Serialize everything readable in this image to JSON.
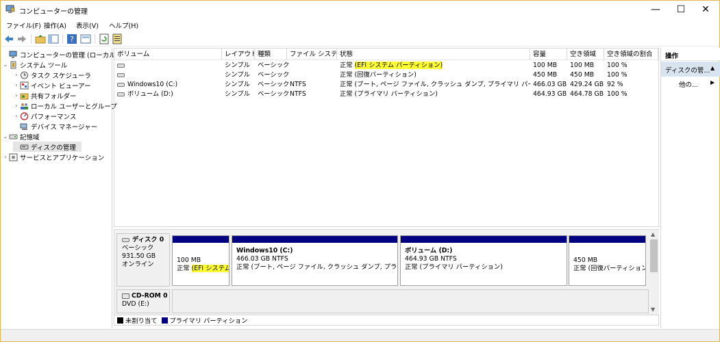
{
  "window": {
    "title": "コンピューターの管理",
    "minimize": "—",
    "maximize": "☐",
    "close": "✕"
  },
  "menu": [
    "ファイル(F)",
    "操作(A)",
    "表示(V)",
    "ヘルプ(H)"
  ],
  "tree": [
    {
      "label": "コンピューターの管理 (ローカル)",
      "icon": "computer-management-icon"
    },
    {
      "label": "システム ツール",
      "icon": "tools-icon"
    },
    {
      "label": "タスク スケジューラ",
      "icon": "clock-icon"
    },
    {
      "label": "イベント ビューアー",
      "icon": "event-viewer-icon"
    },
    {
      "label": "共有フォルダー",
      "icon": "shared-folder-icon"
    },
    {
      "label": "ローカル ユーザーとグループ",
      "icon": "users-icon"
    },
    {
      "label": "パフォーマンス",
      "icon": "performance-icon"
    },
    {
      "label": "デバイス マネージャー",
      "icon": "device-manager-icon"
    },
    {
      "label": "記憶域",
      "icon": "storage-icon"
    },
    {
      "label": "ディスクの管理",
      "icon": "disk-management-icon"
    },
    {
      "label": "サービスとアプリケーション",
      "icon": "services-icon"
    }
  ],
  "columns": [
    "ボリューム",
    "レイアウト",
    "種類",
    "ファイル システム",
    "状態",
    "容量",
    "空き領域",
    "空き領域の割合"
  ],
  "volumes": [
    {
      "name": "",
      "layout": "シンプル",
      "type": "ベーシック",
      "fs": "",
      "status": "正常 (EFI システム パーティション)",
      "capacity": "100 MB",
      "free": "100 MB",
      "pct": "100 %"
    },
    {
      "name": "",
      "layout": "シンプル",
      "type": "ベーシック",
      "fs": "",
      "status": "正常 (回復パーティション)",
      "capacity": "450 MB",
      "free": "450 MB",
      "pct": "100 %"
    },
    {
      "name": "Windows10 (C:)",
      "layout": "シンプル",
      "type": "ベーシック",
      "fs": "NTFS",
      "status": "正常 (ブート, ページ ファイル, クラッシュ ダンプ, プライマリ パーティション)",
      "capacity": "466.03 GB",
      "free": "429.24 GB",
      "pct": "92 %"
    },
    {
      "name": "ボリューム (D:)",
      "layout": "シンプル",
      "type": "ベーシック",
      "fs": "NTFS",
      "status": "正常 (プライマリ パーティション)",
      "capacity": "464.93 GB",
      "free": "464.78 GB",
      "pct": "100 %"
    }
  ],
  "actions": {
    "header": "操作",
    "group": "ディスクの管...",
    "other": "他の..."
  },
  "disk0": {
    "name": "ディスク 0",
    "type": "ベーシック",
    "size": "931.50 GB",
    "state": "オンライン"
  },
  "partitions": [
    {
      "title": "",
      "size": "100 MB",
      "status": "正常 (EFI システム"
    },
    {
      "title": "Windows10  (C:)",
      "size": "466.03 GB NTFS",
      "status": "正常 (ブート, ページ ファイル, クラッシュ ダンプ, プライマリ パー"
    },
    {
      "title": "ボリューム  (D:)",
      "size": "464.93 GB NTFS",
      "status": "正常 (プライマリ パーティション)"
    },
    {
      "title": "",
      "size": "450 MB",
      "status": "正常 (回復パーティション)"
    }
  ],
  "cdrom": {
    "name": "CD-ROM 0",
    "drive": "DVD (E:)"
  },
  "legend": {
    "unallocated": "未割り当て",
    "primary": "プライマリ パーティション",
    "unallocated_color": "#000000",
    "primary_color": "#000080"
  }
}
